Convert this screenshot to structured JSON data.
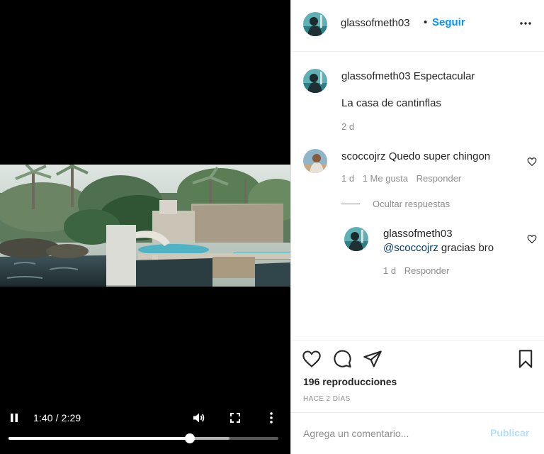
{
  "video": {
    "current_time": "1:40",
    "duration": "2:29",
    "time_display": "1:40 / 2:29",
    "progress_fraction": 0.671,
    "buffered_fraction": 0.82,
    "icons": {
      "pause": "pause-icon",
      "volume": "volume-icon",
      "fullscreen": "fullscreen-icon",
      "more": "more-vertical-icon"
    }
  },
  "header": {
    "username": "glassofmeth03",
    "separator": "•",
    "follow_label": "Seguir",
    "options_label": "•••"
  },
  "caption": {
    "username": "glassofmeth03",
    "text": "Espectacular",
    "second_line": "La casa de cantinflas",
    "time": "2 d"
  },
  "comments": [
    {
      "username": "scoccojrz",
      "text": "Quedo super chingon",
      "time": "1 d",
      "likes_label": "1 Me gusta",
      "reply_label": "Responder",
      "hide_replies_label": "Ocultar respuestas",
      "replies": [
        {
          "username": "glassofmeth03",
          "mention": "@scoccojrz",
          "text": "gracias bro",
          "time": "1 d",
          "reply_label": "Responder"
        }
      ]
    }
  ],
  "actions": {
    "icons": [
      "heart-icon",
      "comment-icon",
      "share-icon",
      "bookmark-icon"
    ],
    "views": "196 reproducciones",
    "date": "HACE 2 DÍAS"
  },
  "comment_box": {
    "placeholder": "Agrega un comentario...",
    "publish_label": "Publicar"
  },
  "colors": {
    "accent": "#0095f6",
    "publish_disabled": "#b2dffc",
    "muted_text": "#8e8e8e",
    "mention": "#00376b",
    "video_background": "#000000"
  }
}
